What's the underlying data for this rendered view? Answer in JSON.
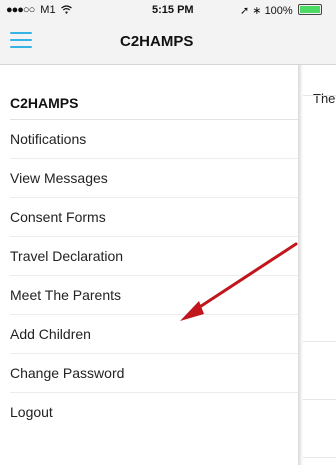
{
  "status_bar": {
    "signal_dots": "●●●○○",
    "carrier": "M1",
    "wifi_icon": "wifi-icon",
    "time": "5:15 PM",
    "location_arrow": "➚",
    "bluetooth": "∗",
    "battery_text": "100%",
    "battery_level": 1.0
  },
  "nav": {
    "title": "C2HAMPS",
    "menu_icon": "hamburger-icon"
  },
  "drawer": {
    "header": "C2HAMPS",
    "items": [
      {
        "label": "Notifications"
      },
      {
        "label": "View Messages"
      },
      {
        "label": "Consent Forms"
      },
      {
        "label": "Travel Declaration"
      },
      {
        "label": "Meet The Parents"
      },
      {
        "label": "Add Children"
      },
      {
        "label": "Change Password"
      },
      {
        "label": "Logout"
      }
    ]
  },
  "background": {
    "partial_text": "The"
  },
  "annotation": {
    "arrow_color": "#c0161c"
  }
}
